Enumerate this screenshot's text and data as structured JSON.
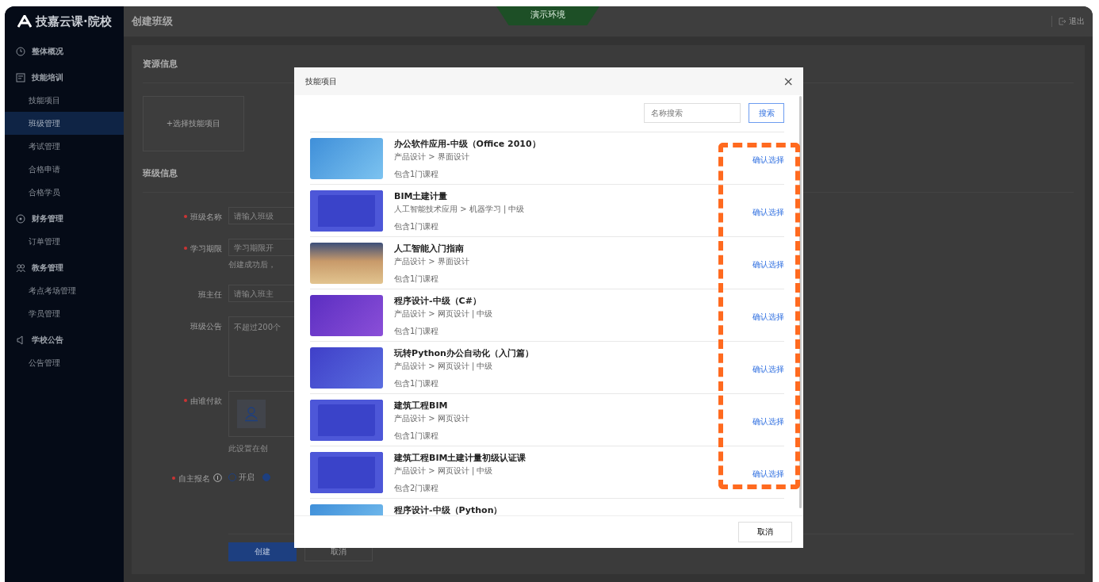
{
  "sidebar": {
    "logo": "技嘉云课·院校",
    "groups": [
      {
        "label": "整体概况"
      },
      {
        "label": "技能培训",
        "children": [
          {
            "label": "技能项目",
            "selected": false
          },
          {
            "label": "班级管理",
            "selected": true
          },
          {
            "label": "考试管理",
            "selected": false
          },
          {
            "label": "合格申请",
            "selected": false
          },
          {
            "label": "合格学员",
            "selected": false
          }
        ]
      },
      {
        "label": "财务管理",
        "children": [
          {
            "label": "订单管理",
            "selected": false
          }
        ]
      },
      {
        "label": "教务管理",
        "children": [
          {
            "label": "考点考场管理",
            "selected": false
          },
          {
            "label": "学员管理",
            "selected": false
          }
        ]
      },
      {
        "label": "学校公告",
        "children": [
          {
            "label": "公告管理",
            "selected": false
          }
        ]
      }
    ]
  },
  "header": {
    "title": "创建班级",
    "env_badge": "演示环境",
    "logout": "退出"
  },
  "page": {
    "resource_section": "资源信息",
    "select_project": "+选择技能项目",
    "class_section": "班级信息",
    "fields": [
      {
        "kind": "input",
        "label": "班级名称",
        "required": true,
        "placeholder": "请输入班级"
      },
      {
        "kind": "input",
        "label": "学习期限",
        "required": true,
        "placeholder": "学习期限开",
        "hint": "创建成功后，"
      },
      {
        "kind": "input",
        "label": "班主任",
        "required": false,
        "placeholder": "请输入班主"
      },
      {
        "kind": "textarea",
        "label": "班级公告",
        "required": false,
        "placeholder": "不超过200个"
      },
      {
        "kind": "payer",
        "label": "由谁付款",
        "required": true,
        "hint": "此设置在创"
      },
      {
        "kind": "radio",
        "label": "自主报名",
        "required": true,
        "options": [
          {
            "label": "开启",
            "selected": false
          },
          {
            "selected": true
          }
        ]
      }
    ],
    "buttons": [
      {
        "label": "创建",
        "kind": "primary"
      },
      {
        "label": "取消",
        "kind": "default"
      }
    ]
  },
  "modal": {
    "title": "技能项目",
    "close": "×",
    "search": {
      "placeholder": "名称搜索",
      "button": "搜索"
    },
    "items": [
      {
        "title": "办公软件应用-中级（Office 2010）",
        "path": "产品设计 > 界面设计",
        "count": "包含1门课程",
        "action": "确认选择",
        "kind": "python"
      },
      {
        "title": "BIM土建计量",
        "path": "人工智能技术应用 > 机器学习 | 中级",
        "count": "包含1门课程",
        "action": "确认选择",
        "kind": "bim"
      },
      {
        "title": "人工智能入门指南",
        "path": "产品设计 > 界面设计",
        "count": "包含1门课程",
        "action": "确认选择",
        "kind": "photo"
      },
      {
        "title": "程序设计-中级（C#）",
        "path": "产品设计 > 网页设计 | 中级",
        "count": "包含1门课程",
        "action": "确认选择",
        "kind": "csharp"
      },
      {
        "title": "玩转Python办公自动化（入门篇）",
        "path": "产品设计 > 网页设计 | 中级",
        "count": "包含1门课程",
        "action": "确认选择",
        "kind": "office"
      },
      {
        "title": "建筑工程BIM",
        "path": "产品设计 > 网页设计",
        "count": "包含1门课程",
        "action": "确认选择",
        "kind": "bim"
      },
      {
        "title": "建筑工程BIM土建计量初级认证课",
        "path": "产品设计 > 网页设计 | 中级",
        "count": "包含2门课程",
        "action": "确认选择",
        "kind": "bim"
      },
      {
        "title": "程序设计-中级（Python）",
        "kind": "python"
      }
    ],
    "cancel": "取消",
    "action_highlight": true
  }
}
